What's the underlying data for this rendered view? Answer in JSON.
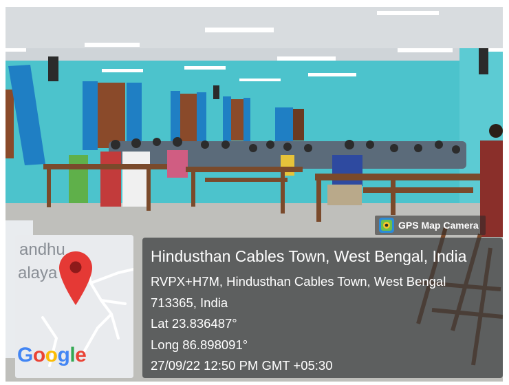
{
  "overlay": {
    "badge_label": "GPS Map Camera",
    "badge_icon": "gps-map-camera-icon",
    "location_title": "Hindusthan Cables Town, West Bengal, India",
    "address_line1": "RVPX+H7M, Hindusthan Cables Town, West Bengal",
    "address_line2": "713365, India",
    "latitude": "Lat 23.836487°",
    "longitude": "Long 86.898091°",
    "timestamp": "27/09/22 12:50 PM GMT +05:30"
  },
  "map": {
    "label_top": "andhu",
    "label_middle": "alaya",
    "logo": {
      "letters": [
        "G",
        "o",
        "o",
        "g",
        "l",
        "e"
      ],
      "colors": [
        "#4285F4",
        "#EA4335",
        "#FBBC05",
        "#4285F4",
        "#34A853",
        "#EA4335"
      ]
    },
    "pin_icon": "location-pin-icon",
    "pin_color": "#E53935"
  },
  "colors": {
    "wall": "#4cc3cc",
    "curtain": "#1f7fc4",
    "bench": "#7a4a2b"
  }
}
